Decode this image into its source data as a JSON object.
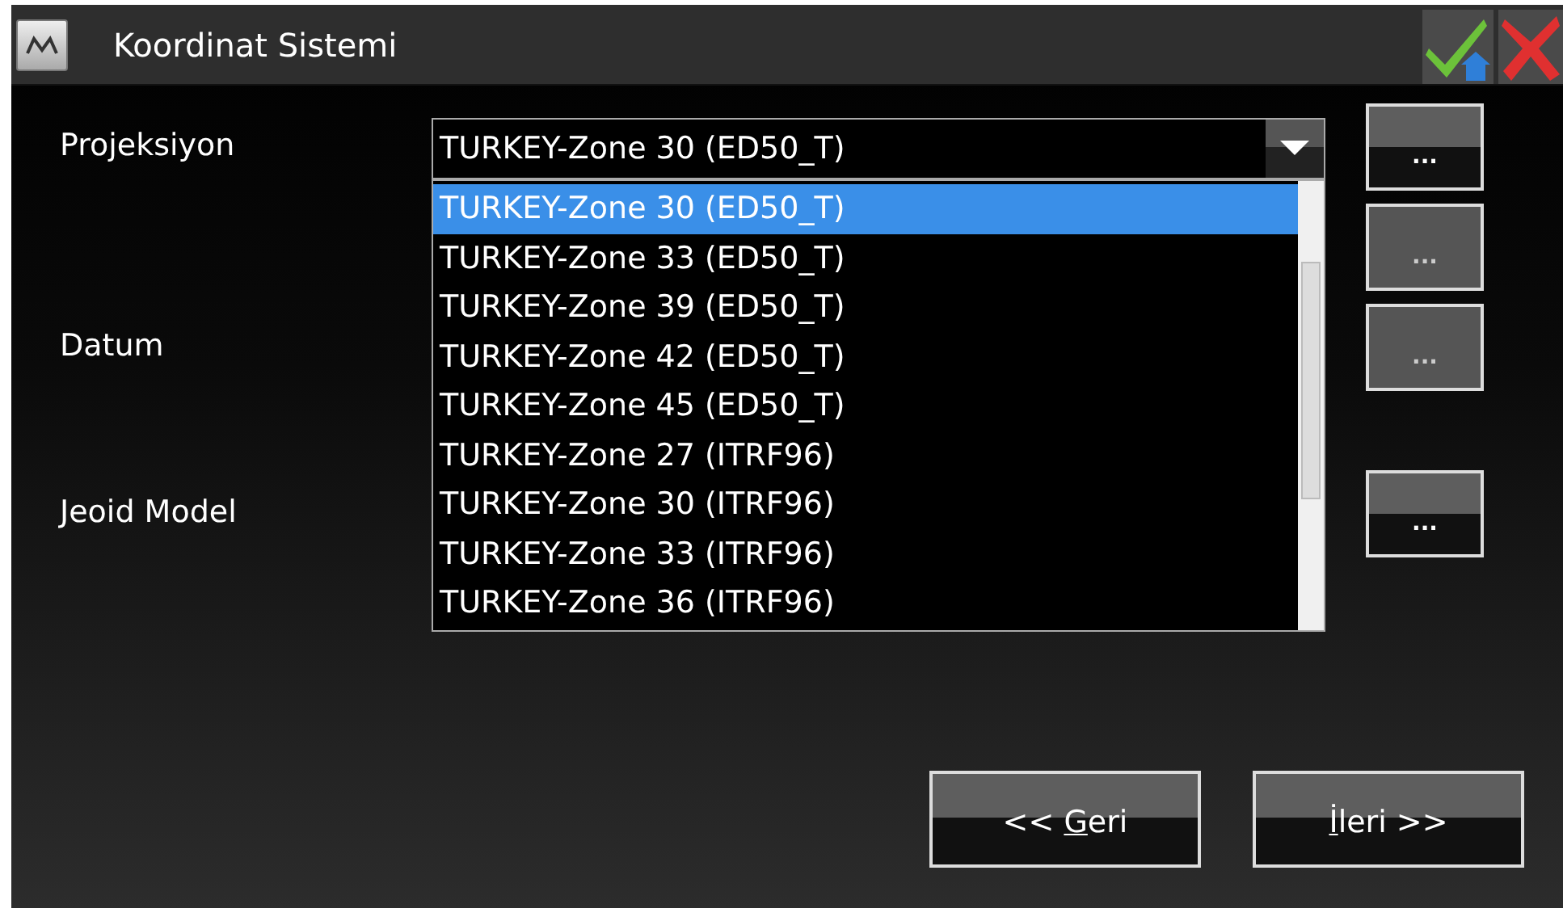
{
  "window": {
    "title": "Koordinat Sistemi"
  },
  "fields": [
    {
      "label": "Projeksiyon",
      "kind": "dropdown",
      "value": "TURKEY-Zone 30 (ED50_T)",
      "expanded": true,
      "button": {
        "label": "...",
        "disabled": false
      }
    },
    {
      "kind": "none",
      "button": {
        "label": "...",
        "disabled": true
      }
    },
    {
      "label": "Datum",
      "kind": "none",
      "button": {
        "label": "...",
        "disabled": true
      }
    },
    {
      "label": "Jeoid Model",
      "kind": "none",
      "button": {
        "label": "...",
        "disabled": false
      }
    }
  ],
  "options": [
    {
      "label": "TURKEY-Zone 30 (ED50_T)",
      "selected": true
    },
    {
      "label": "TURKEY-Zone 33 (ED50_T)",
      "selected": false
    },
    {
      "label": "TURKEY-Zone 39 (ED50_T)",
      "selected": false
    },
    {
      "label": "TURKEY-Zone 42 (ED50_T)",
      "selected": false
    },
    {
      "label": "TURKEY-Zone 45 (ED50_T)",
      "selected": false
    },
    {
      "label": "TURKEY-Zone 27 (ITRF96)",
      "selected": false
    },
    {
      "label": "TURKEY-Zone 30 (ITRF96)",
      "selected": false
    },
    {
      "label": "TURKEY-Zone 33 (ITRF96)",
      "selected": false
    },
    {
      "label": "TURKEY-Zone 36 (ITRF96)",
      "selected": false
    }
  ],
  "nav_buttons": [
    {
      "before": "<< ",
      "access_key": "G",
      "after": "eri"
    },
    {
      "access_key": "İ",
      "after": "leri >>"
    }
  ]
}
